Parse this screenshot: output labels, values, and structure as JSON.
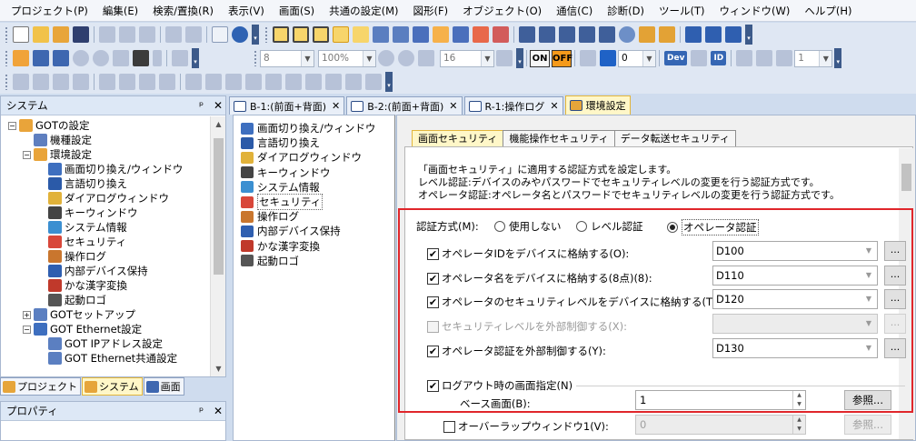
{
  "menu": [
    "プロジェクト(P)",
    "編集(E)",
    "検索/置換(R)",
    "表示(V)",
    "画面(S)",
    "共通の設定(M)",
    "図形(F)",
    "オブジェクト(O)",
    "通信(C)",
    "診断(D)",
    "ツール(T)",
    "ウィンドウ(W)",
    "ヘルプ(H)"
  ],
  "toolbar": {
    "font_size": "8",
    "zoom": "100%",
    "line_width": "16",
    "on_label": "ON",
    "off_label": "OFF",
    "state_value": "0",
    "dev_label": "Dev",
    "id_label": "ID",
    "layer_value": "1"
  },
  "system_panel": {
    "title": "システム",
    "pin": "ᵖ",
    "close": "✕",
    "tree": [
      {
        "label": "GOTの設定",
        "level": 0,
        "expander": "−"
      },
      {
        "label": "機種設定",
        "level": 1
      },
      {
        "label": "環境設定",
        "level": 1,
        "expander": "−"
      },
      {
        "label": "画面切り換え/ウィンドウ",
        "level": 2
      },
      {
        "label": "言語切り換え",
        "level": 2
      },
      {
        "label": "ダイアログウィンドウ",
        "level": 2
      },
      {
        "label": "キーウィンドウ",
        "level": 2
      },
      {
        "label": "システム情報",
        "level": 2
      },
      {
        "label": "セキュリティ",
        "level": 2
      },
      {
        "label": "操作ログ",
        "level": 2
      },
      {
        "label": "内部デバイス保持",
        "level": 2
      },
      {
        "label": "かな漢字変換",
        "level": 2
      },
      {
        "label": "起動ロゴ",
        "level": 2
      },
      {
        "label": "GOTセットアップ",
        "level": 1,
        "expander": "+"
      },
      {
        "label": "GOT Ethernet設定",
        "level": 1,
        "expander": "−"
      },
      {
        "label": "GOT IPアドレス設定",
        "level": 2
      },
      {
        "label": "GOT Ethernet共通設定",
        "level": 2
      }
    ]
  },
  "bottom_tabs": [
    {
      "label": "プロジェクト",
      "selected": false
    },
    {
      "label": "システム",
      "selected": true
    },
    {
      "label": "画面",
      "selected": false
    }
  ],
  "property_panel": {
    "title": "プロパティ"
  },
  "doc_tabs": [
    {
      "label": "B-1:(前面+背面)",
      "selected": false
    },
    {
      "label": "B-2:(前面+背面)",
      "selected": false
    },
    {
      "label": "R-1:操作ログ",
      "selected": false
    },
    {
      "label": "環境設定",
      "selected": true
    }
  ],
  "env_list": [
    "画面切り換え/ウィンドウ",
    "言語切り換え",
    "ダイアログウィンドウ",
    "キーウィンドウ",
    "システム情報",
    "セキュリティ",
    "操作ログ",
    "内部デバイス保持",
    "かな漢字変換",
    "起動ロゴ"
  ],
  "env_list_selected": "セキュリティ",
  "security": {
    "tabs": [
      "画面セキュリティ",
      "機能操作セキュリティ",
      "データ転送セキュリティ"
    ],
    "description": [
      "「画面セキュリティ」に適用する認証方式を設定します。",
      "レベル認証:デバイスのみやパスワードでセキュリティレベルの変更を行う認証方式です。",
      "オペレータ認証:オペレータ名とパスワードでセキュリティレベルの変更を行う認証方式です。"
    ],
    "auth_method_label": "認証方式(M):",
    "auth_options": [
      "使用しない",
      "レベル認証",
      "オペレータ認証"
    ],
    "auth_selected": "オペレータ認証",
    "settings": [
      {
        "label": "オペレータIDをデバイスに格納する(O):",
        "checked": true,
        "enabled": true,
        "device": "D100"
      },
      {
        "label": "オペレータ名をデバイスに格納する(8点)(8):",
        "checked": true,
        "enabled": true,
        "device": "D110"
      },
      {
        "label": "オペレータのセキュリティレベルをデバイスに格納する(T):",
        "checked": true,
        "enabled": true,
        "device": "D120"
      },
      {
        "label": "セキュリティレベルを外部制御する(X):",
        "checked": false,
        "enabled": false,
        "device": ""
      },
      {
        "label": "オペレータ認証を外部制御する(Y):",
        "checked": true,
        "enabled": true,
        "device": "D130"
      }
    ],
    "ellipsis": "...",
    "logout_label": "ログアウト時の画面指定(N)",
    "logout_checked": true,
    "base_screen_label": "ベース画面(B):",
    "base_screen_value": "1",
    "browse_label": "参照...",
    "overlap_label": "オーバーラップウィンドウ1(V):",
    "overlap_value": "0",
    "overlap_browse_label": "参照...",
    "highlight_color": "#e0262b"
  }
}
